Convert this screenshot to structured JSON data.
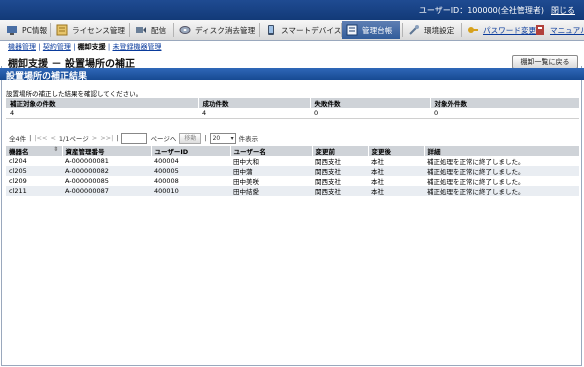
{
  "header": {
    "user_info": "ユーザーID：100000(全社管理者)",
    "logout": "閉じる"
  },
  "menu": [
    {
      "label": "PC情報",
      "icon": "pc-icon",
      "color": "#4a6fa5"
    },
    {
      "label": "ライセンス管理",
      "icon": "license-icon",
      "color": "#c79a2b"
    },
    {
      "label": "配信",
      "icon": "distribution-icon",
      "color": "#6a7f98"
    },
    {
      "label": "ディスク消去管理",
      "icon": "disk-erase-icon",
      "color": "#7d8fa8"
    },
    {
      "label": "スマートデバイス",
      "icon": "smart-device-icon",
      "color": "#3d4e66"
    },
    {
      "label": "管理台帳",
      "icon": "ledger-icon",
      "color": "#f0f4fa"
    },
    {
      "label": "環境設定",
      "icon": "settings-icon",
      "color": "#5f7794"
    },
    {
      "label": "パスワード変更",
      "icon": "key-icon",
      "color": "#d7a11c"
    },
    {
      "label": "マニュアル",
      "icon": "manual-icon",
      "color": "#b1403a"
    }
  ],
  "breadcrumb": {
    "items": [
      "機器管理",
      "契約管理",
      "棚卸支援",
      "未登録機器管理"
    ],
    "sep": "|"
  },
  "page": {
    "title": "棚卸支援 － 設置場所の補正",
    "back_button": "棚卸一覧に戻る",
    "section_title": "設置場所の補正結果",
    "description": "設置場所の補正した結果を確認してください。"
  },
  "summary": {
    "headers": [
      "補正対象の件数",
      "成功件数",
      "失敗件数",
      "対象外件数"
    ],
    "values": [
      "4",
      "4",
      "0",
      "0"
    ]
  },
  "pager": {
    "total": "全4件",
    "first": "|<<",
    "prev": "<",
    "page_info": "1/1ページ",
    "next": ">",
    "last": ">>|",
    "goto_label": "ページへ",
    "goto_value": "",
    "move_button": "移動",
    "per_page": "20",
    "per_page_label": "件表示"
  },
  "table": {
    "columns": [
      "機器名",
      "資産管理番号",
      "ユーザーID",
      "ユーザー名",
      "変更前",
      "変更後",
      "詳細"
    ],
    "sort_icon": "⇳",
    "rows": [
      [
        "cl204",
        "A-000000081",
        "400004",
        "田中大和",
        "関西支社",
        "本社",
        "補正処理を正常に終了しました。"
      ],
      [
        "cl205",
        "A-000000082",
        "400005",
        "田中蒲",
        "関西支社",
        "本社",
        "補正処理を正常に終了しました。"
      ],
      [
        "cl209",
        "A-000000085",
        "400008",
        "田中美咲",
        "関西支社",
        "本社",
        "補正処理を正常に終了しました。"
      ],
      [
        "cl211",
        "A-000000087",
        "400010",
        "田中結愛",
        "関西支社",
        "本社",
        "補正処理を正常に終了しました。"
      ]
    ]
  }
}
